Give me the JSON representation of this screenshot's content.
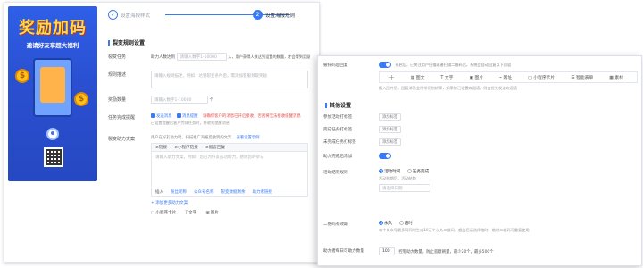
{
  "poster": {
    "title": "奖励加码",
    "subtitle": "邀请好友享超大福利",
    "coin_symbol": "$"
  },
  "steps": [
    {
      "num": "✓",
      "label": "设置海报样式"
    },
    {
      "num": "2",
      "label": "设置海报规则"
    }
  ],
  "main": {
    "section_title": "裂变规则设置",
    "rows": {
      "goal": {
        "label": "裂变任务",
        "prefix": "助力人数达到",
        "input_placeholder": "请输入数字1-10000",
        "suffix": "人，用户获得人数达到设置的数量，才会得到奖励"
      },
      "desc": {
        "label": "规则描述",
        "placeholder": "请输入规则描述，例如：达到裂变条件后，需添加客服领取奖励"
      },
      "reward": {
        "label": "奖励数量",
        "input_placeholder": "请输入数字1-10000",
        "unit": "个"
      },
      "notify": {
        "label": "任务完成提醒",
        "opt1": "发送消息",
        "opt2": "消息提醒",
        "warn": "请确保客户的消息已开启接收，否则将无法接收提醒消息",
        "line2": "已设置提醒后客户完成任务时，将收到提醒消息"
      },
      "copy": {
        "label": "裂变助力文案",
        "hint": "用户在好友助力时，扫描推广海报后收到的文案",
        "link": "查看设置示例",
        "tabs": [
          "链接",
          "小程序链接",
          "留言回复"
        ],
        "placeholder": "请输入助力文案，例如：您已为好友成功助力，感谢您的参与",
        "foot": [
          "插入",
          "粉丝昵称",
          "公众号名称",
          "裂变数据剩余",
          "助力者链接"
        ]
      }
    },
    "add_link": "+ 添加更多助力文案",
    "tools": [
      "小程序卡片",
      "文字",
      "图片"
    ]
  },
  "overlay": {
    "auto_reply": {
      "label": "被扫码后回复",
      "toggle_note": "开启后，已关注用户扫描或者扫描二维码后，系统会自动回复以下内容",
      "tools": [
        "图文",
        "文字",
        "图片",
        "网址",
        "小程序卡片",
        "智能表单",
        "素材"
      ],
      "sub_note": "插入图片后，回复消息会附带识别结果，如果你已设置欢迎语，则会优先发送欢迎语"
    },
    "other_section_title": "其他设置",
    "fields": [
      {
        "label": "参加活动打标签",
        "button": "添加标签"
      },
      {
        "label": "完成任务打标签",
        "button": "添加标签"
      },
      {
        "label": "未完成任务打标签",
        "button": "添加标签"
      }
    ],
    "helper_tag": {
      "label": "助力完成后添加"
    },
    "end_time": {
      "label": "活动结束规则",
      "opt1": "活动时间",
      "opt2": "任务完成",
      "note": "活动到期后，活动结束",
      "input_placeholder": "请选择日期"
    },
    "qr_valid": {
      "label": "二维码有效期",
      "opt1": "永久",
      "opt2": "临时",
      "note": "每个公众号最多可同时生成10万个永久二维码，超出后请选择临时，临时二维码可重复使用"
    },
    "max_per": {
      "label": "助力者每日可助力数量",
      "value": "100",
      "suffix": "控制助力数量，防止恶意刷量，最少20个，最多500个"
    }
  }
}
